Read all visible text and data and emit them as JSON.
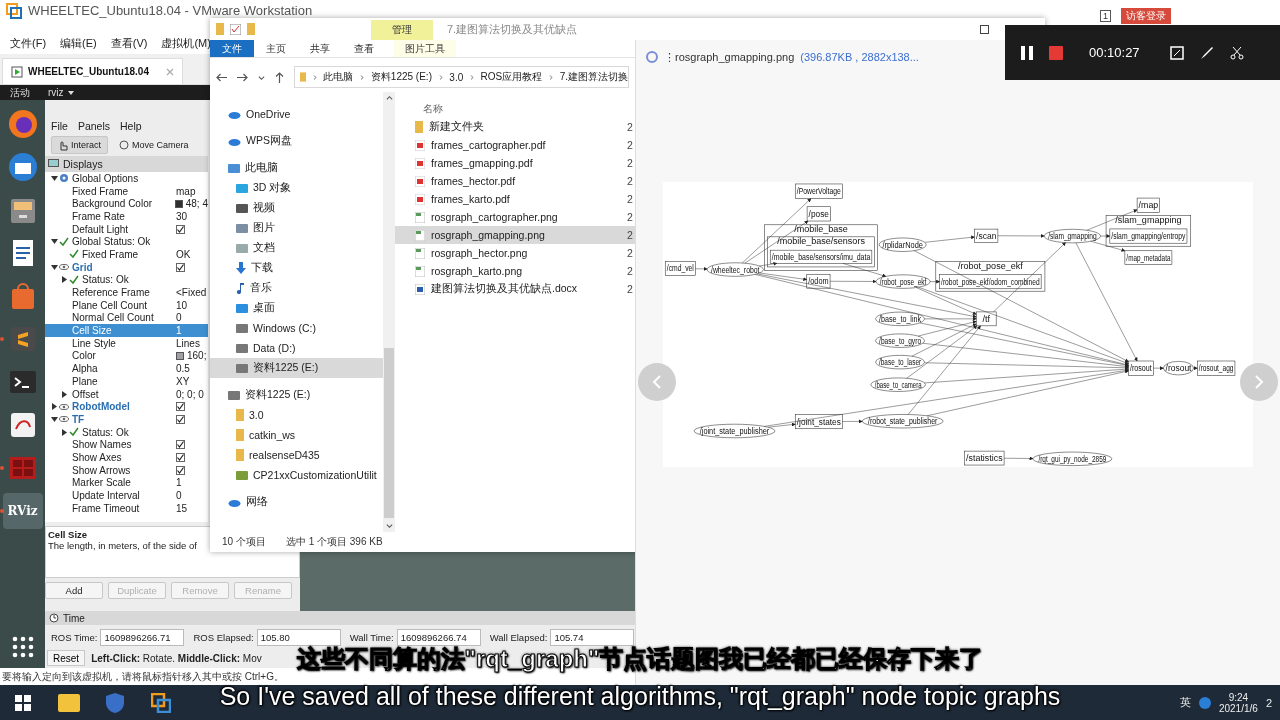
{
  "vmware": {
    "title": "WHEELTEC_Ubuntu18.04 - VMware Workstation",
    "menu": [
      "文件(F)",
      "编辑(E)",
      "查看(V)",
      "虚拟机(M)"
    ],
    "tab": "WHEELTEC_Ubuntu18.04",
    "badge": "1",
    "guest_login": "访客登录",
    "status_hint": "要将输入定向到该虚拟机，请将鼠标指针移入其中或按 Ctrl+G。"
  },
  "ubuntu_bar": {
    "activities": "活动",
    "app": "rviz"
  },
  "dock": [
    {
      "kind": "firefox",
      "running": false,
      "selected": false
    },
    {
      "kind": "mail",
      "running": false,
      "selected": false
    },
    {
      "kind": "files",
      "running": false,
      "selected": false
    },
    {
      "kind": "writer",
      "running": false,
      "selected": false
    },
    {
      "kind": "software",
      "running": false,
      "selected": false
    },
    {
      "kind": "sublime",
      "running": true,
      "selected": false
    },
    {
      "kind": "terminal",
      "running": false,
      "selected": false
    },
    {
      "kind": "viewer",
      "running": false,
      "selected": false
    },
    {
      "kind": "grid",
      "running": true,
      "selected": false
    },
    {
      "kind": "rviz",
      "label": "RViz",
      "running": true,
      "selected": true
    }
  ],
  "rviz": {
    "menu": [
      "File",
      "Panels",
      "Help"
    ],
    "tools": [
      {
        "kind": "interact",
        "label": "Interact",
        "selected": true
      },
      {
        "kind": "camera",
        "label": "Move Camera",
        "selected": false
      }
    ],
    "displays_title": "Displays",
    "tree": [
      {
        "kind": "options",
        "label": "Global Options",
        "expanded": true,
        "selected": false,
        "children": [
          {
            "kind": "property",
            "label": "Fixed Frame",
            "value": "map",
            "selected": false
          },
          {
            "kind": "property",
            "label": "Background Color",
            "value": "48; 4",
            "color": "#303030",
            "selected": false
          },
          {
            "kind": "property",
            "label": "Frame Rate",
            "value": "30",
            "selected": false
          },
          {
            "kind": "property",
            "label": "Default Light",
            "checked": true,
            "selected": false
          }
        ]
      },
      {
        "kind": "status",
        "label": "Global Status: Ok",
        "expanded": true,
        "selected": false,
        "children": [
          {
            "kind": "status",
            "label": "Fixed Frame",
            "value": "OK",
            "selected": false
          }
        ]
      },
      {
        "kind": "display",
        "label": "Grid",
        "expanded": true,
        "checked": true,
        "selected": false,
        "children": [
          {
            "kind": "status",
            "label": "Status: Ok",
            "expanded": false,
            "selected": false
          },
          {
            "kind": "property",
            "label": "Reference Frame",
            "value": "<Fixed",
            "selected": false
          },
          {
            "kind": "property",
            "label": "Plane Cell Count",
            "value": "10",
            "selected": false
          },
          {
            "kind": "property",
            "label": "Normal Cell Count",
            "value": "0",
            "selected": false
          },
          {
            "kind": "property",
            "label": "Cell Size",
            "value": "1",
            "selected": true
          },
          {
            "kind": "property",
            "label": "Line Style",
            "value": "Lines",
            "selected": false
          },
          {
            "kind": "property",
            "label": "Color",
            "value": "160;",
            "color": "#a0a0a4",
            "selected": false
          },
          {
            "kind": "property",
            "label": "Alpha",
            "value": "0.5",
            "selected": false
          },
          {
            "kind": "property",
            "label": "Plane",
            "value": "XY",
            "selected": false
          },
          {
            "kind": "property",
            "label": "Offset",
            "value": "0; 0; 0",
            "expanded": false,
            "selected": false
          }
        ]
      },
      {
        "kind": "display",
        "label": "RobotModel",
        "expanded": false,
        "checked": true,
        "selected": false
      },
      {
        "kind": "display",
        "label": "TF",
        "expanded": true,
        "checked": true,
        "selected": false,
        "children": [
          {
            "kind": "status",
            "label": "Status: Ok",
            "expanded": false,
            "selected": false
          },
          {
            "kind": "property",
            "label": "Show Names",
            "checked": true,
            "selected": false
          },
          {
            "kind": "property",
            "label": "Show Axes",
            "checked": true,
            "selected": false
          },
          {
            "kind": "property",
            "label": "Show Arrows",
            "checked": true,
            "selected": false
          },
          {
            "kind": "property",
            "label": "Marker Scale",
            "value": "1",
            "selected": false
          },
          {
            "kind": "property",
            "label": "Update Interval",
            "value": "0",
            "selected": false
          },
          {
            "kind": "property",
            "label": "Frame Timeout",
            "value": "15",
            "selected": false
          }
        ]
      }
    ],
    "description": {
      "title": "Cell Size",
      "text": "The length, in meters, of the side of"
    },
    "buttons": [
      {
        "label": "Add",
        "disabled": false
      },
      {
        "label": "Duplicate",
        "disabled": true
      },
      {
        "label": "Remove",
        "disabled": true
      },
      {
        "label": "Rename",
        "disabled": true
      }
    ],
    "time_title": "Time",
    "time_fields": [
      {
        "label": "ROS Time:",
        "value": "1609896266.71"
      },
      {
        "label": "ROS Elapsed:",
        "value": "105.80"
      },
      {
        "label": "Wall Time:",
        "value": "1609896266.74"
      },
      {
        "label": "Wall Elapsed:",
        "value": "105.74"
      }
    ],
    "reset": "Reset",
    "hint": "**Left-Click:** Rotate. **Middle-Click:** Mov"
  },
  "explorer": {
    "manage_tab": "管理",
    "title": "7.建图算法切换及其优缺点",
    "ribbon_tabs": [
      {
        "label": "文件",
        "selected": true
      },
      {
        "label": "主页",
        "selected": false
      },
      {
        "label": "共享",
        "selected": false
      },
      {
        "label": "查看",
        "selected": false
      },
      {
        "label": "图片工具",
        "selected": false
      }
    ],
    "path": [
      "此电脑",
      "资料1225 (E:)",
      "3.0",
      "ROS应用教程",
      "7.建图算法切换"
    ],
    "nav": [
      {
        "kind": "cloud",
        "label": "OneDrive",
        "selected": false
      },
      {
        "kind": "wps",
        "label": "WPS网盘",
        "selected": false
      },
      {
        "kind": "pc",
        "label": "此电脑",
        "selected": false,
        "children": [
          {
            "kind": "cube",
            "label": "3D 对象",
            "selected": false
          },
          {
            "kind": "video",
            "label": "视频",
            "selected": false
          },
          {
            "kind": "picture",
            "label": "图片",
            "selected": false
          },
          {
            "kind": "doc",
            "label": "文档",
            "selected": false
          },
          {
            "kind": "download",
            "label": "下载",
            "selected": false
          },
          {
            "kind": "music",
            "label": "音乐",
            "selected": false
          },
          {
            "kind": "desktop",
            "label": "桌面",
            "selected": false
          },
          {
            "kind": "drive",
            "label": "Windows (C:)",
            "selected": false
          },
          {
            "kind": "drive",
            "label": "Data (D:)",
            "selected": false
          },
          {
            "kind": "drive",
            "label": "资料1225 (E:)",
            "selected": true
          }
        ]
      },
      {
        "kind": "drive",
        "label": "资料1225 (E:)",
        "selected": false,
        "children": [
          {
            "kind": "folder",
            "label": "3.0",
            "selected": false
          },
          {
            "kind": "folder",
            "label": "catkin_ws",
            "selected": false
          },
          {
            "kind": "folder",
            "label": "realsenseD435",
            "selected": false
          },
          {
            "kind": "archive",
            "label": "CP21xxCustomizationUtilit",
            "selected": false
          }
        ]
      },
      {
        "kind": "network",
        "label": "网络",
        "selected": false
      }
    ],
    "column_name": "名称",
    "files": [
      {
        "kind": "folder",
        "name": "新建文件夹",
        "column_2": "2",
        "selected": false
      },
      {
        "kind": "pdf",
        "name": "frames_cartographer.pdf",
        "column_2": "2",
        "selected": false
      },
      {
        "kind": "pdf",
        "name": "frames_gmapping.pdf",
        "column_2": "2",
        "selected": false
      },
      {
        "kind": "pdf",
        "name": "frames_hector.pdf",
        "column_2": "2",
        "selected": false
      },
      {
        "kind": "pdf",
        "name": "frames_karto.pdf",
        "column_2": "2",
        "selected": false
      },
      {
        "kind": "png",
        "name": "rosgraph_cartographer.png",
        "column_2": "2",
        "selected": false
      },
      {
        "kind": "png",
        "name": "rosgraph_gmapping.png",
        "column_2": "2",
        "selected": true
      },
      {
        "kind": "png",
        "name": "rosgraph_hector.png",
        "column_2": "2",
        "selected": false
      },
      {
        "kind": "png",
        "name": "rosgraph_karto.png",
        "column_2": "2",
        "selected": false
      },
      {
        "kind": "docx",
        "name": "建图算法切换及其优缺点.docx",
        "column_2": "2",
        "selected": false
      }
    ],
    "item_count": "10 个项目",
    "selection": "选中 1 个项目  396 KB"
  },
  "viewer": {
    "file_name": "⋮rosgraph_gmapping.png",
    "file_info": "(396.87KB , 2882x138...",
    "graph_nodes": [
      {
        "kind": "box",
        "label": "/PowerVoltage"
      },
      {
        "kind": "box",
        "label": "/pose"
      },
      {
        "kind": "cluster",
        "label": "/mobile_base"
      },
      {
        "kind": "cluster",
        "label": "/mobile_base/sensors"
      },
      {
        "kind": "box",
        "label": "/mobile_base/sensors/imu_data"
      },
      {
        "kind": "box",
        "label": "/cmd_vel"
      },
      {
        "kind": "ellipse",
        "label": "/wheeltec_robot"
      },
      {
        "kind": "box",
        "label": "/odom"
      },
      {
        "kind": "ellipse",
        "label": "/rplidarNode"
      },
      {
        "kind": "box",
        "label": "/scan"
      },
      {
        "kind": "ellipse",
        "label": "/slam_gmapping"
      },
      {
        "kind": "box",
        "label": "/map"
      },
      {
        "kind": "cluster",
        "label": "/slam_gmapping"
      },
      {
        "kind": "box",
        "label": "/slam_gmapping/entropy"
      },
      {
        "kind": "box",
        "label": "/map_metadata"
      },
      {
        "kind": "ellipse",
        "label": "/robot_pose_ekf"
      },
      {
        "kind": "cluster",
        "label": "/robot_pose_ekf"
      },
      {
        "kind": "box",
        "label": "/robot_pose_ekf/odom_combined"
      },
      {
        "kind": "box",
        "label": "/tf"
      },
      {
        "kind": "ellipse",
        "label": "/base_to_link"
      },
      {
        "kind": "ellipse",
        "label": "/base_to_gyro"
      },
      {
        "kind": "ellipse",
        "label": "/base_to_laser"
      },
      {
        "kind": "ellipse",
        "label": "/base_to_camera"
      },
      {
        "kind": "box",
        "label": "/rosout"
      },
      {
        "kind": "ellipse",
        "label": "/rosout"
      },
      {
        "kind": "box",
        "label": "/rosout_agg"
      },
      {
        "kind": "ellipse",
        "label": "/joint_state_publisher"
      },
      {
        "kind": "box",
        "label": "/joint_states"
      },
      {
        "kind": "ellipse",
        "label": "/robot_state_publisher"
      },
      {
        "kind": "box",
        "label": "/statistics"
      },
      {
        "kind": "ellipse",
        "label": "/rqt_gui_py_node_2859"
      }
    ]
  },
  "recorder": {
    "time": "00:10:27"
  },
  "taskbar": {
    "ime": "英",
    "time": "9:24",
    "date": "2021/1/6",
    "notifications": "2"
  },
  "subtitles": {
    "zh": "这些不同算的法\"rqt_graph\"节点话题图我已经都已经保存下来了",
    "en": "So I've saved all of these different algorithms, \"rqt_graph\" node topic graphs"
  }
}
